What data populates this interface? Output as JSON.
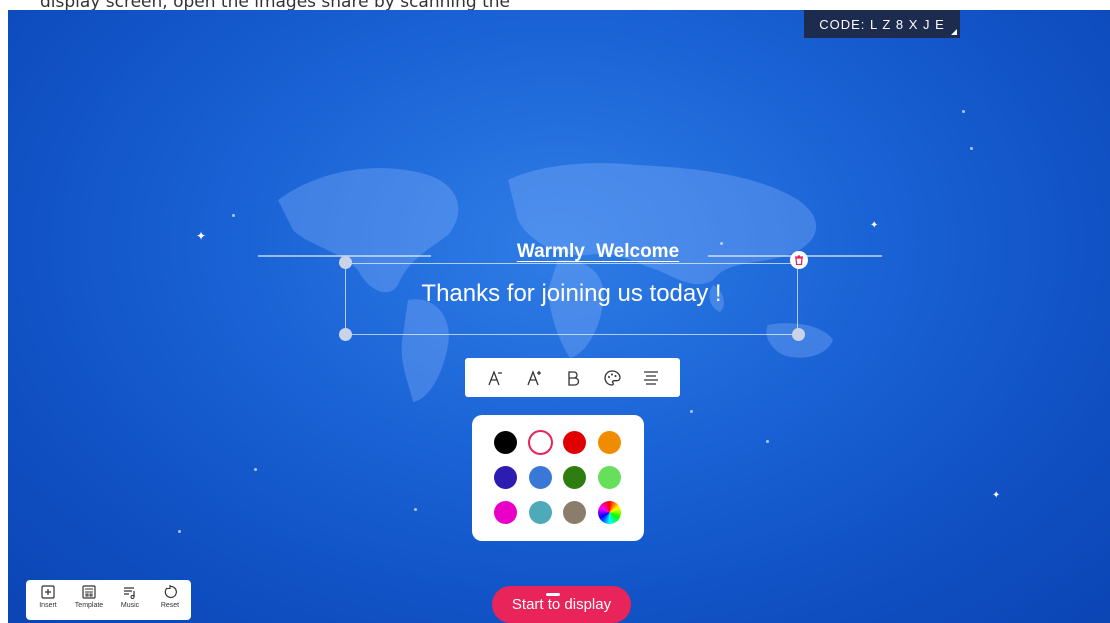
{
  "header": {
    "ghost_text": "display screen, open the images share by scanning the"
  },
  "code_badge": {
    "label": "CODE:",
    "code": "L Z 8 X J E"
  },
  "card": {
    "heading": "Warmly  Welcome",
    "message": "Thanks for joining us today !"
  },
  "format_bar": {
    "tools": [
      "decrease-font-icon",
      "increase-font-icon",
      "bold-icon",
      "palette-icon",
      "align-icon"
    ]
  },
  "palette": {
    "selected": "#ffffff",
    "colors": [
      "#000000",
      "#ffffff",
      "#e00000",
      "#f08c00",
      "#2d1cb0",
      "#3a78d8",
      "#2e7d10",
      "#66e05a",
      "#e800c8",
      "#4ea9b8",
      "#8b7d6b",
      "spectrum"
    ]
  },
  "toolbar": {
    "items": [
      {
        "label": "Insert",
        "icon": "plus-square-icon"
      },
      {
        "label": "Template",
        "icon": "template-icon"
      },
      {
        "label": "Music",
        "icon": "music-list-icon"
      },
      {
        "label": "Reset",
        "icon": "reset-icon"
      }
    ]
  },
  "start_button": {
    "label": "Start to display"
  },
  "colors": {
    "background": "#1a63d6",
    "accent": "#e8245a",
    "badge": "#1d2b4e"
  }
}
